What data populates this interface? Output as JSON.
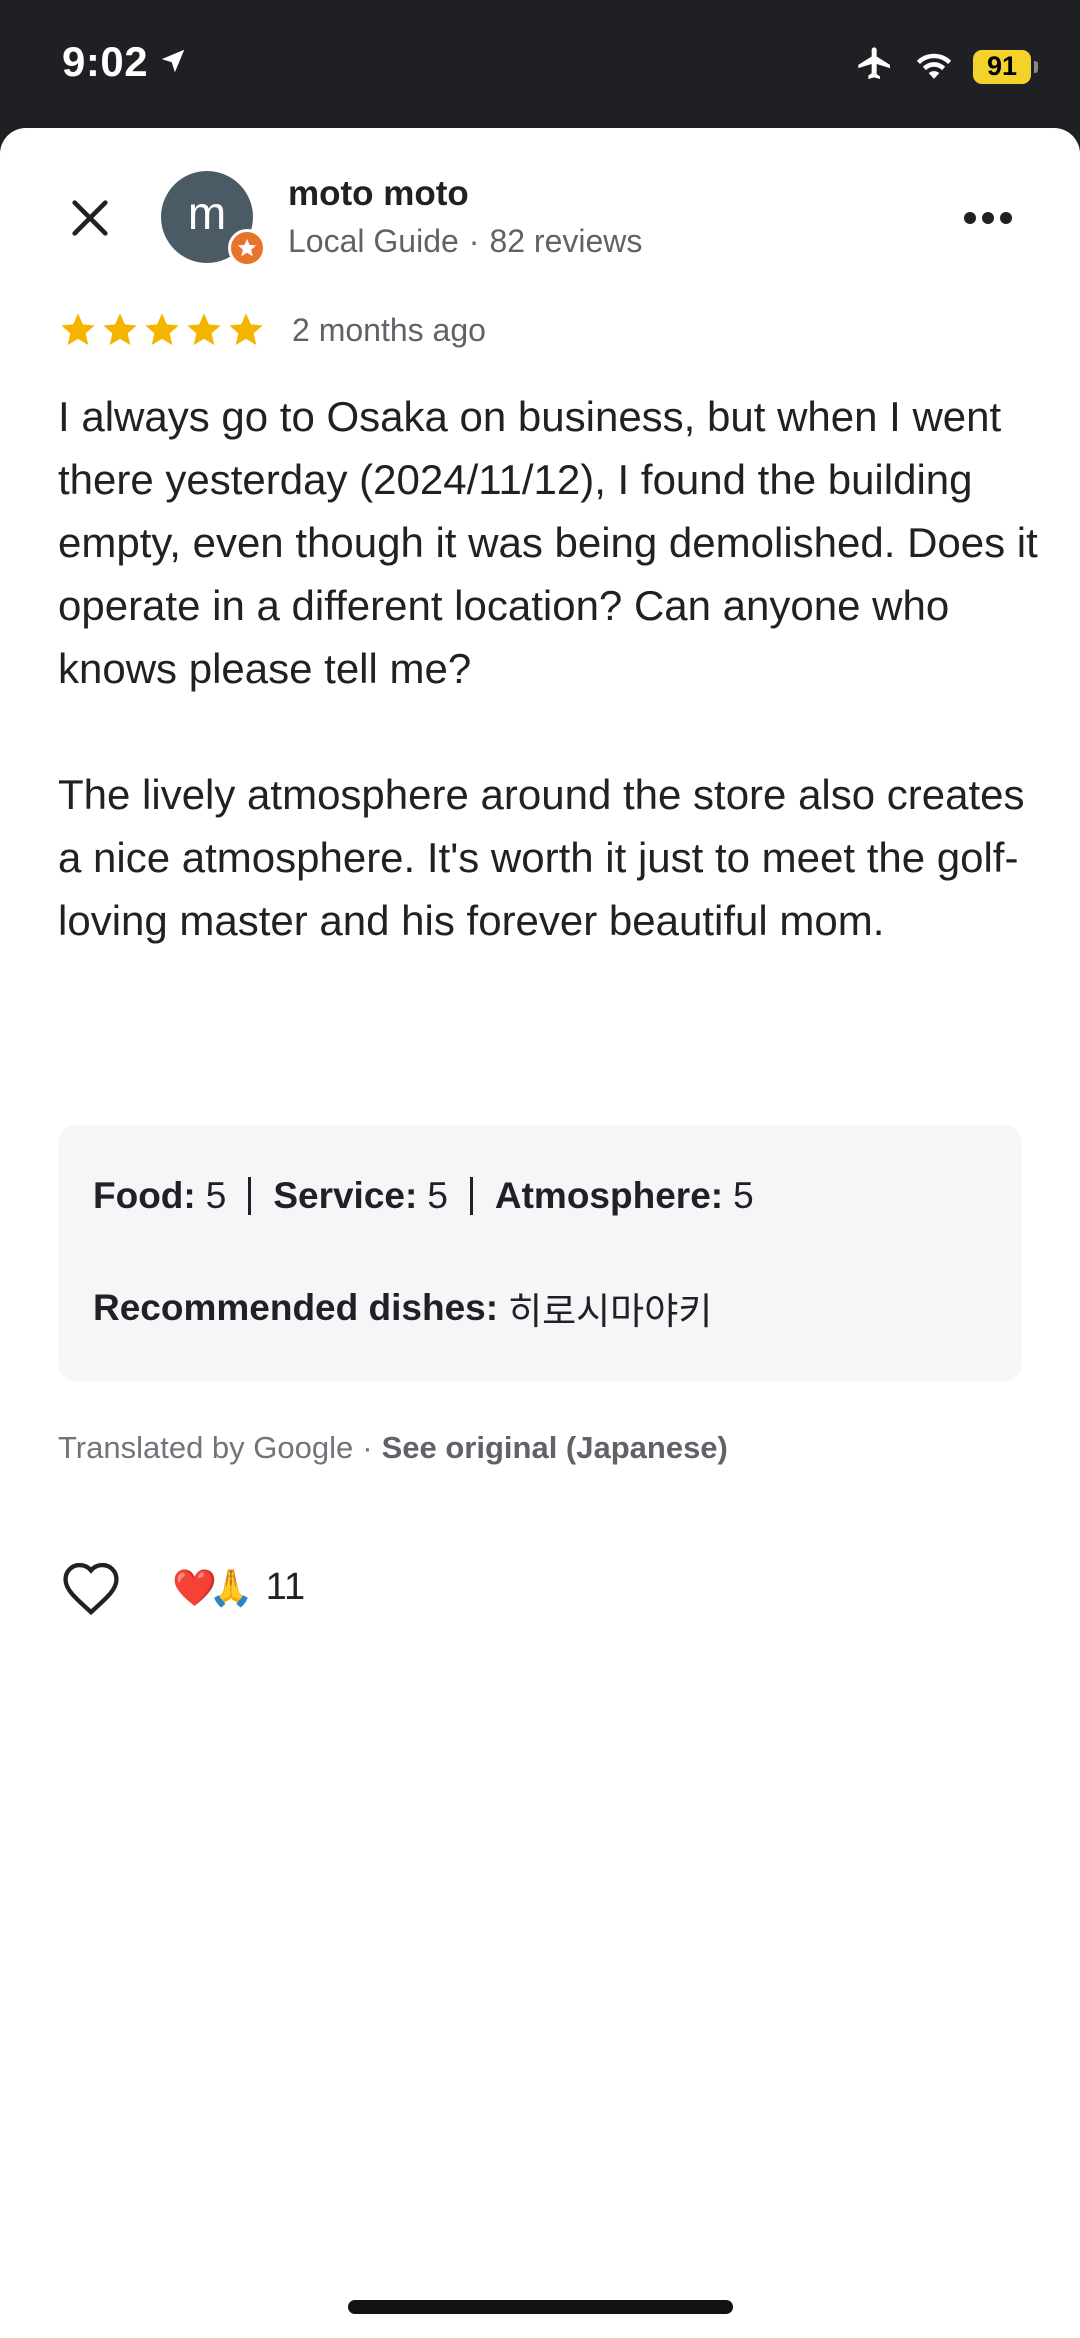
{
  "status_bar": {
    "time": "9:02",
    "battery": "91",
    "icons": [
      "location-arrow-icon",
      "airplane-icon",
      "wifi-icon",
      "battery-icon"
    ],
    "battery_color": "#f3d22b"
  },
  "review": {
    "user": {
      "avatar_letter": "m",
      "name": "moto moto",
      "guide_label": "Local Guide",
      "separator": "·",
      "reviews": "82 reviews",
      "avatar_color": "#4a5b66",
      "badge_color": "#e9732d"
    },
    "rating": 5,
    "max_rating": 5,
    "star_color": "#f4b400",
    "date": "2 months ago",
    "paragraphs": [
      "I always go to Osaka on business, but when I went there yesterday (2024/11/12), I found the building empty, even though it was being demolished. Does it operate in a different location? Can anyone who knows please tell me?",
      "The lively atmosphere around the store also creates a nice atmosphere. It's worth it just to meet the golf-loving master and his forever beautiful mom."
    ],
    "details": {
      "food_label": "Food:",
      "food_value": "5",
      "service_label": "Service:",
      "service_value": "5",
      "atmosphere_label": "Atmosphere:",
      "atmosphere_value": "5",
      "dishes_label": "Recommended dishes:",
      "dishes_value": "히로시마야키"
    },
    "translation": {
      "text": "Translated by Google",
      "separator": "·",
      "link": "See original (Japanese)"
    },
    "reactions": {
      "emojis": [
        "❤️",
        "🙏"
      ],
      "count": "11"
    }
  }
}
